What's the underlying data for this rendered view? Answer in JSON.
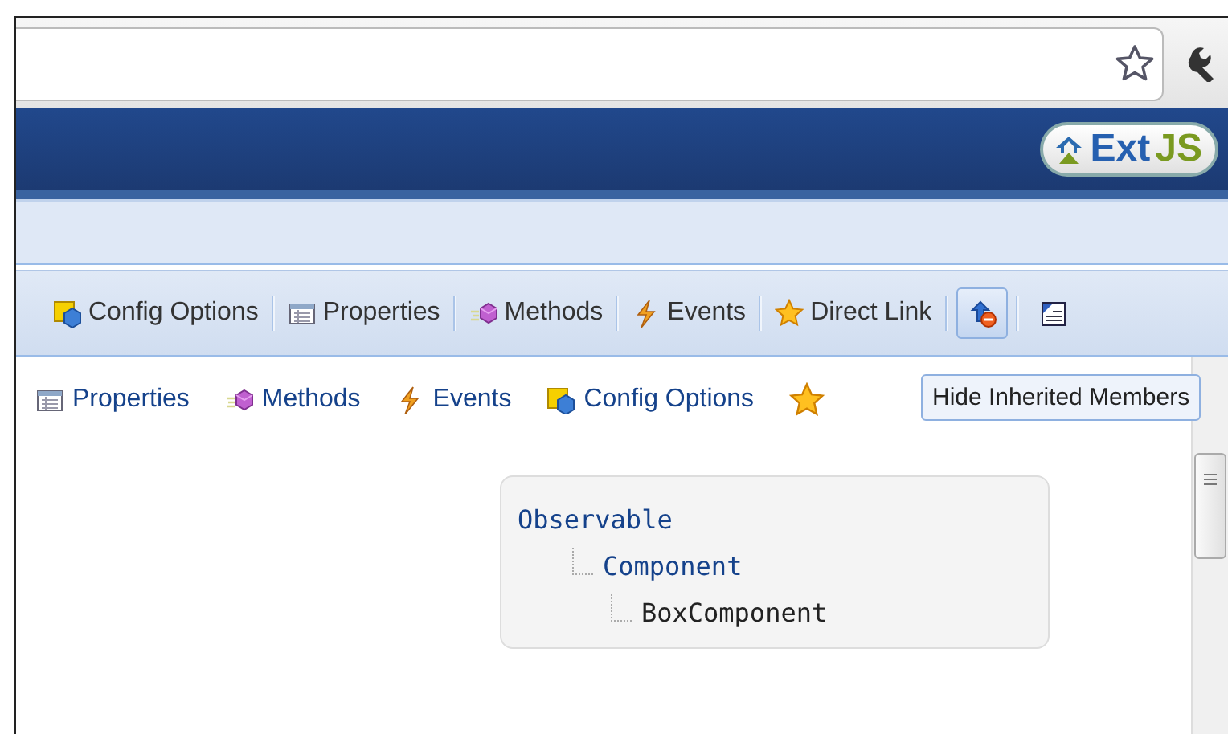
{
  "header": {
    "logo": {
      "word": "Ext",
      "suffix": "JS"
    }
  },
  "toolbar": [
    {
      "kind": "config",
      "label": "Config Options"
    },
    {
      "kind": "properties",
      "label": "Properties"
    },
    {
      "kind": "methods",
      "label": "Methods"
    },
    {
      "kind": "events",
      "label": "Events"
    },
    {
      "kind": "star",
      "label": "Direct Link"
    },
    {
      "kind": "hide-inherited",
      "pressed": true
    },
    {
      "kind": "expand",
      "pressed": false
    }
  ],
  "member_links": [
    {
      "kind": "properties",
      "label": "Properties"
    },
    {
      "kind": "methods",
      "label": "Methods"
    },
    {
      "kind": "events",
      "label": "Events"
    },
    {
      "kind": "config",
      "label": "Config Options"
    },
    {
      "kind": "star"
    }
  ],
  "tooltip": "Hide Inherited Members",
  "hierarchy": [
    {
      "name": "Observable",
      "current": false,
      "children": [
        {
          "name": "Component",
          "current": false,
          "children": [
            {
              "name": "BoxComponent",
              "current": true
            }
          ]
        }
      ]
    }
  ]
}
